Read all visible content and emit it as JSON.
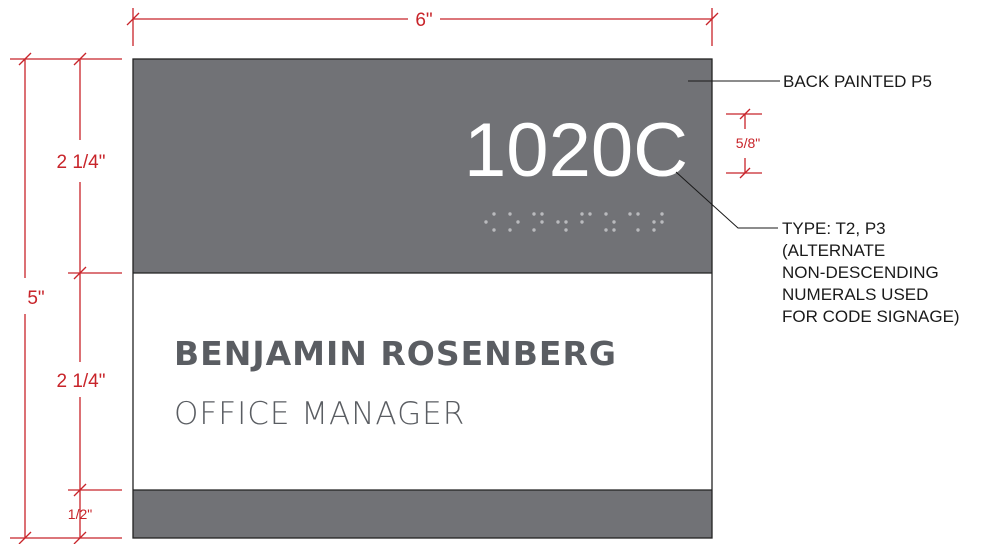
{
  "sign": {
    "room_number": "1020C",
    "name": "BENJAMIN ROSENBERG",
    "title": "OFFICE MANAGER",
    "panel_color": "#717276",
    "text_color": "#ffffff",
    "body_text_color": "#5a5d62"
  },
  "dimensions": {
    "width": "6\"",
    "height": "5\"",
    "top_section": "2 1/4\"",
    "middle_section": "2 1/4\"",
    "bottom_section": "1/2\"",
    "letter_height": "5/8\"",
    "dim_color": "#c8242a"
  },
  "callouts": {
    "back_painted": "BACK PAINTED P5",
    "type_lines": [
      "TYPE: T2, P3",
      "(ALTERNATE",
      "NON-DESCENDING",
      "NUMERALS USED",
      "FOR CODE SIGNAGE)"
    ]
  }
}
